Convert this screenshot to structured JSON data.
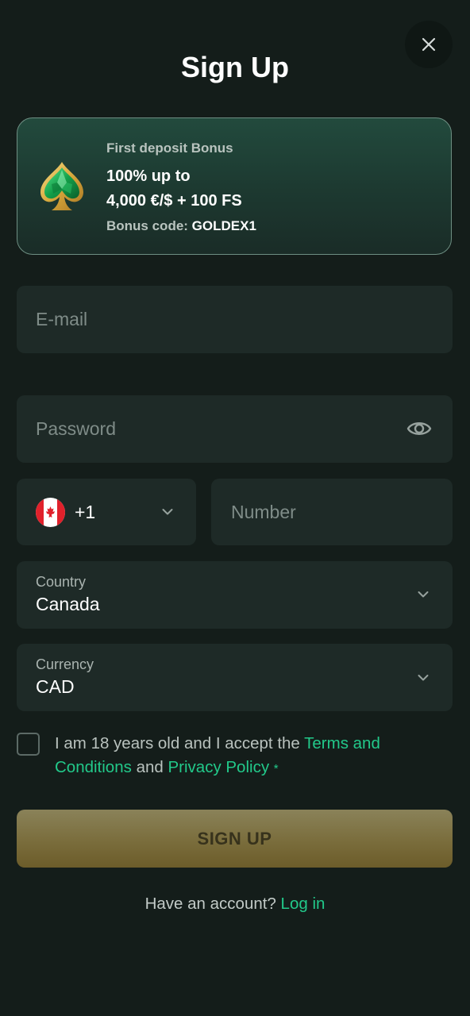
{
  "header": {
    "title": "Sign Up"
  },
  "icons": {
    "close": "close-icon",
    "eye": "eye-icon",
    "chevron": "chevron-down-icon",
    "flag": "canada-flag-icon",
    "bonus": "emerald-spade-icon"
  },
  "bonus": {
    "label": "First deposit Bonus",
    "amount_line1": "100% up to",
    "amount_line2": "4,000 €/$ + 100 FS",
    "code_label": "Bonus code: ",
    "code_value": "GOLDEX1"
  },
  "form": {
    "email": {
      "placeholder": "E-mail",
      "value": ""
    },
    "password": {
      "placeholder": "Password",
      "value": ""
    },
    "phone": {
      "dial_code": "+1",
      "number_placeholder": "Number",
      "number_value": ""
    },
    "country": {
      "label": "Country",
      "value": "Canada"
    },
    "currency": {
      "label": "Currency",
      "value": "CAD"
    },
    "terms": {
      "text_before": "I am 18 years old and I accept the ",
      "terms_link": "Terms and Conditions",
      "text_middle": " and ",
      "privacy_link": "Privacy Policy",
      "required_mark": "*",
      "checked": false
    },
    "submit_label": "SIGN UP"
  },
  "footer": {
    "question": "Have an account? ",
    "login_link": "Log in"
  },
  "colors": {
    "background": "#141d1a",
    "field": "#1e2a27",
    "accent_green": "#22c98a",
    "button_gold": "#7a6d3c"
  }
}
